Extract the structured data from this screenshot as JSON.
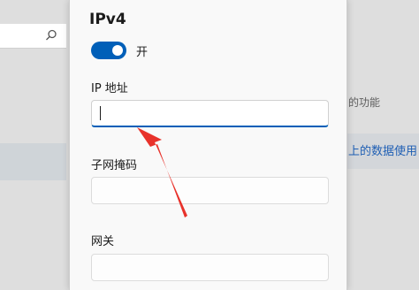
{
  "background": {
    "search_icon": "search-icon",
    "muted_text": "的功能",
    "link_text": "上的数据使用"
  },
  "dialog": {
    "section_title": "IPv4",
    "toggle": {
      "state_label": "开",
      "on": true,
      "color": "#005fb8"
    },
    "fields": {
      "ip_address": {
        "label": "IP 地址",
        "value": ""
      },
      "subnet_mask": {
        "label": "子网掩码",
        "value": ""
      },
      "gateway": {
        "label": "网关",
        "value": ""
      }
    }
  },
  "annotation": {
    "arrow_color": "#e8322b",
    "icon": "red-arrow-annotation"
  }
}
